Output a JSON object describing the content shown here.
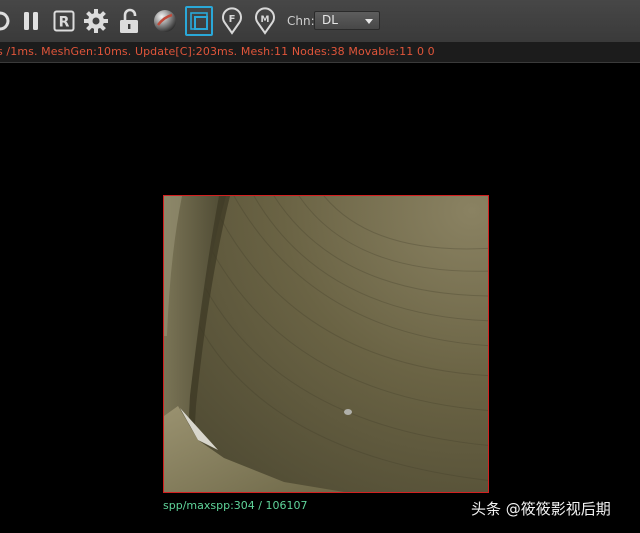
{
  "toolbar": {
    "icons": [
      "refresh-icon",
      "pause-icon",
      "r-icon",
      "gear-icon",
      "unlock-icon",
      "material-sphere-icon",
      "region-render-icon",
      "f-pin-icon",
      "m-pin-icon"
    ],
    "pin_f": "F",
    "pin_m": "M",
    "r_letter": "R",
    "channel_label": "Chn:",
    "channel_value": "DL"
  },
  "status": {
    "text": "s /1ms. MeshGen:10ms. Update[C]:203ms. Mesh:11 Nodes:38 Movable:11  0 0"
  },
  "viewport": {
    "spp_text": "spp/maxspp:304 / 106107"
  },
  "watermark": {
    "text": "头条 @筱筱影视后期"
  },
  "colors": {
    "status_text": "#e0553a",
    "frame_border": "#d22020",
    "spp_text": "#5fd49a",
    "active_outline": "#2aa8d8"
  }
}
